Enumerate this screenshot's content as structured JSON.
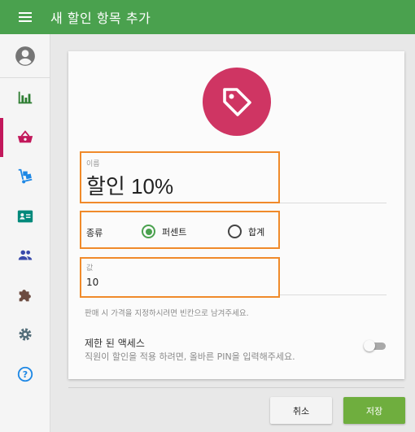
{
  "app_bar": {
    "title": "새 할인 항목 추가"
  },
  "colors": {
    "app_bar": "#4aa14e",
    "accent": "#c2185b",
    "tag_circle": "#cf3563",
    "save_button": "#6fae3e",
    "highlight": "#f08a2a"
  },
  "sidebar": {
    "items": [
      {
        "icon": "account-circle-icon",
        "active": false
      },
      {
        "icon": "bar-chart-icon",
        "active": false
      },
      {
        "icon": "shopping-basket-icon",
        "active": true
      },
      {
        "icon": "hand-truck-icon",
        "active": false
      },
      {
        "icon": "contact-card-icon",
        "active": false
      },
      {
        "icon": "people-icon",
        "active": false
      },
      {
        "icon": "puzzle-icon",
        "active": false
      },
      {
        "icon": "gear-icon",
        "active": false
      },
      {
        "icon": "help-circle-icon",
        "active": false
      }
    ]
  },
  "form": {
    "name_label": "이름",
    "name_value": "할인 10%",
    "type_label": "종류",
    "type_options": [
      {
        "label": "퍼센트",
        "selected": true
      },
      {
        "label": "합계",
        "selected": false
      }
    ],
    "value_label": "값",
    "value_value": "10",
    "hint": "판매 시 가격을 지정하시려면 빈칸으로 남겨주세요.",
    "restricted_title": "제한 된 액세스",
    "restricted_desc": "직원이 할인을 적용 하려면, 올바른 PIN을 입력해주세요.",
    "restricted_on": false
  },
  "buttons": {
    "cancel": "취소",
    "save": "저장"
  }
}
